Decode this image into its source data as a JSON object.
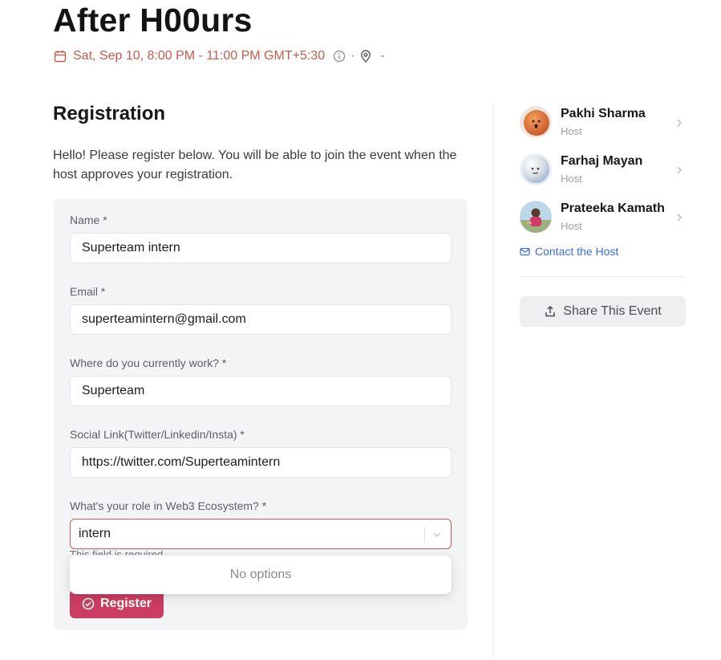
{
  "event": {
    "title": "After H00urs",
    "datetime": "Sat, Sep 10, 8:00 PM - 11:00 PM GMT+5:30",
    "separator1": "·",
    "location_dash": "-"
  },
  "registration": {
    "title": "Registration",
    "intro": "Hello! Please register below. You will be able to join the event when the host approves your registration.",
    "fields": [
      {
        "label": "Name *",
        "value": "Superteam intern"
      },
      {
        "label": "Email *",
        "value": "superteamintern@gmail.com"
      },
      {
        "label": "Where do you currently work? *",
        "value": "Superteam"
      },
      {
        "label": "Social Link(Twitter/Linkedin/Insta) *",
        "value": "https://twitter.com/Superteamintern"
      },
      {
        "label": "What's your role in Web3 Ecosystem? *",
        "value": "intern"
      }
    ],
    "helper_text": "This field is required",
    "dropdown_empty": "No options",
    "register_label": "Register"
  },
  "hosts": [
    {
      "name": "Pakhi Sharma",
      "role": "Host"
    },
    {
      "name": "Farhaj Mayan",
      "role": "Host"
    },
    {
      "name": "Prateeka Kamath",
      "role": "Host"
    }
  ],
  "contact_label": "Contact the Host",
  "share_label": "Share This Event",
  "colors": {
    "accent": "#cc3d63",
    "date": "#c45b4a",
    "link": "#3b6fd8",
    "select_border": "#d3525e"
  }
}
